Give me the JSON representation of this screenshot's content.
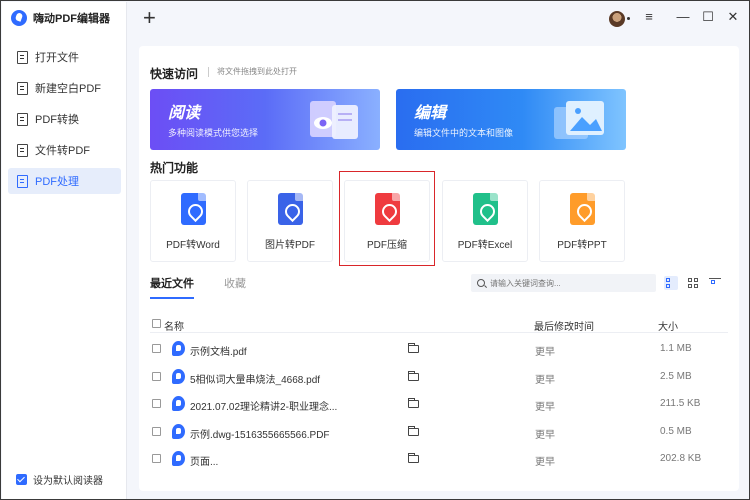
{
  "app": {
    "title": "嗨动PDF编辑器"
  },
  "sidebar": {
    "items": [
      {
        "label": "打开文件",
        "icon": "open-file-icon"
      },
      {
        "label": "新建空白PDF",
        "icon": "new-pdf-icon"
      },
      {
        "label": "PDF转换",
        "icon": "convert-icon"
      },
      {
        "label": "文件转PDF",
        "icon": "file-to-pdf-icon"
      },
      {
        "label": "PDF处理",
        "icon": "pdf-process-icon",
        "active": true
      }
    ],
    "default_reader": {
      "label": "设为默认阅读器",
      "checked": true
    }
  },
  "titlebar": {
    "new_tab": "+",
    "minimize": "—",
    "maximize": "☐",
    "close": "✕",
    "menu": "≡"
  },
  "quick_access": {
    "title": "快速访问",
    "hint": "将文件拖拽到此处打开",
    "banners": [
      {
        "title": "阅读",
        "desc": "多种阅读模式供您选择"
      },
      {
        "title": "编辑",
        "desc": "编辑文件中的文本和图像"
      }
    ]
  },
  "hot_features": {
    "title": "热门功能",
    "tiles": [
      {
        "label": "PDF转Word",
        "color": "#2f6bff"
      },
      {
        "label": "图片转PDF",
        "color": "#3a63e8"
      },
      {
        "label": "PDF压缩",
        "color": "#ef3b3f"
      },
      {
        "label": "PDF转Excel",
        "color": "#20c08a"
      },
      {
        "label": "PDF转PPT",
        "color": "#ff9c2a"
      }
    ]
  },
  "files": {
    "tabs": [
      "最近文件",
      "收藏"
    ],
    "search_placeholder": "请输入关键词查询...",
    "columns": {
      "name": "名称",
      "modified": "最后修改时间",
      "size": "大小"
    },
    "rows": [
      {
        "name": "示例文档.pdf",
        "modified": "更早",
        "size": "1.1 MB"
      },
      {
        "name": "5相似词大量串烧法_4668.pdf",
        "modified": "更早",
        "size": "2.5 MB"
      },
      {
        "name": "2021.07.02理论精讲2-职业理念...",
        "modified": "更早",
        "size": "211.5 KB"
      },
      {
        "name": "示例.dwg-1516355665566.PDF",
        "modified": "更早",
        "size": "0.5 MB"
      },
      {
        "name": "页面...",
        "modified": "更早",
        "size": "202.8 KB"
      }
    ]
  },
  "colors": {
    "accent": "#2f6bff",
    "highlight": "#d9262a"
  }
}
